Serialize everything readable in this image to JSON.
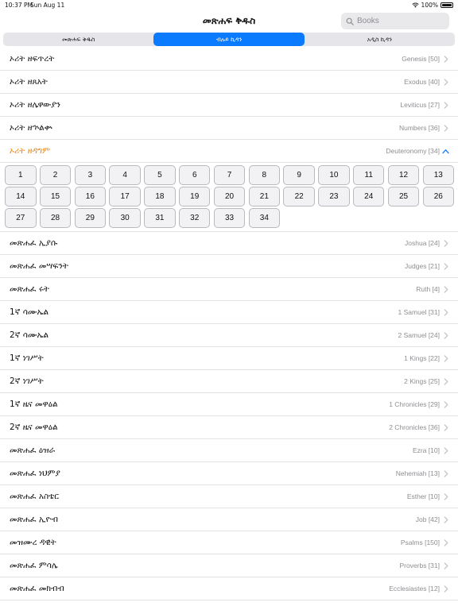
{
  "status": {
    "time": "10:37 PM",
    "date": "Sun Aug 11",
    "battery": "100%"
  },
  "nav": {
    "title": "መጽሐፍ ቅዱስ",
    "search_placeholder": "Books"
  },
  "tabs": [
    {
      "label": "መጽሐፍ ቅዱስ",
      "active": false
    },
    {
      "label": "ብሉይ ኪዳን",
      "active": true
    },
    {
      "label": "አዲስ ኪዳን",
      "active": false
    }
  ],
  "books_top": [
    {
      "amharic": "ኦሪት ዘፍጥረት",
      "english": "Genesis [50]"
    },
    {
      "amharic": "ኦሪት ዘጸአት",
      "english": "Exodus [40]"
    },
    {
      "amharic": "ኦሪት ዘሌዋውያን",
      "english": "Leviticus [27]"
    },
    {
      "amharic": "ኦሪት ዘኍልቍ",
      "english": "Numbers [36]"
    }
  ],
  "expanded_book": {
    "amharic": "ኦሪት ዘዳግም",
    "english": "Deuteronomy [34]",
    "chapters": [
      "1",
      "2",
      "3",
      "4",
      "5",
      "6",
      "7",
      "8",
      "9",
      "10",
      "11",
      "12",
      "13",
      "14",
      "15",
      "16",
      "17",
      "18",
      "19",
      "20",
      "21",
      "22",
      "23",
      "24",
      "25",
      "26",
      "27",
      "28",
      "29",
      "30",
      "31",
      "32",
      "33",
      "34"
    ]
  },
  "books_bottom": [
    {
      "amharic": "መጽሐፈ ኢያሱ",
      "english": "Joshua [24]"
    },
    {
      "amharic": "መጽሐፈ መሣፍንት",
      "english": "Judges [21]"
    },
    {
      "amharic": "መጽሐፈ ሩት",
      "english": "Ruth [4]"
    },
    {
      "amharic": "1ኛ ሳሙኤል",
      "english": "1 Samuel [31]"
    },
    {
      "amharic": "2ኛ ሳሙኤል",
      "english": "2 Samuel [24]"
    },
    {
      "amharic": "1ኛ ነገሥት",
      "english": "1 Kings [22]"
    },
    {
      "amharic": "2ኛ ነገሥት",
      "english": "2 Kings [25]"
    },
    {
      "amharic": "1ኛ ዜና መዋዕል",
      "english": "1 Chronicles [29]"
    },
    {
      "amharic": "2ኛ ዜና መዋዕል",
      "english": "2 Chronicles [36]"
    },
    {
      "amharic": "መጽሐፈ ዕዝራ",
      "english": "Ezra [10]"
    },
    {
      "amharic": "መጽሐፈ ነህምያ",
      "english": "Nehemiah [13]"
    },
    {
      "amharic": "መጽሐፈ አስቴር",
      "english": "Esther [10]"
    },
    {
      "amharic": "መጽሐፈ ኢዮብ",
      "english": "Job [42]"
    },
    {
      "amharic": "መዝሙረ ዳዊት",
      "english": "Psalms [150]"
    },
    {
      "amharic": "መጽሐፈ ምሳሌ",
      "english": "Proverbs [31]"
    },
    {
      "amharic": "መጽሐፈ መክብብ",
      "english": "Ecclesiastes [12]"
    }
  ],
  "colors": {
    "accent": "#0a7aff",
    "expanded_text": "#f0860b",
    "secondary_text": "#8e8e93"
  }
}
